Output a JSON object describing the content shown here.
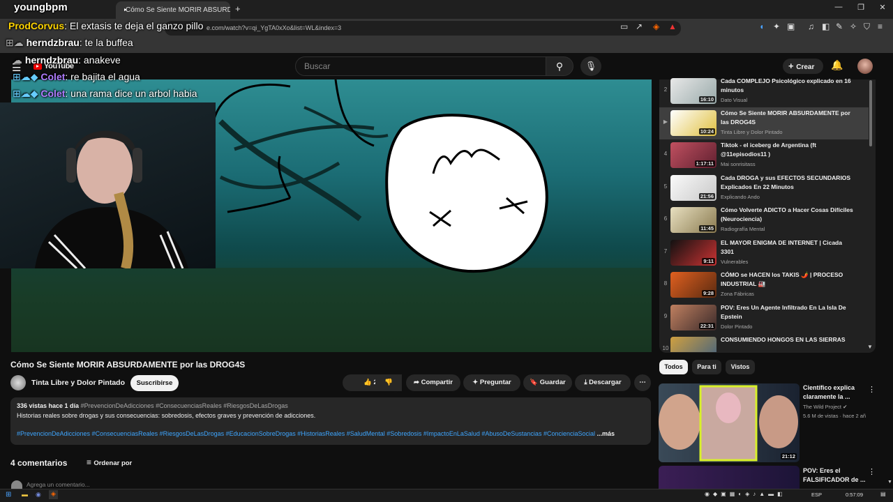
{
  "browser": {
    "active_tab_title": "Cómo Se Siente MORIR ABSURD",
    "new_tab": "+",
    "url": "e.com/watch?v=qi_YgTA0xXo&list=WL&index=3"
  },
  "youtube": {
    "logo": "YouTube",
    "search_placeholder": "Buscar",
    "create_label": "Crear"
  },
  "chat": [
    {
      "name": "youngbpm",
      "message": ""
    },
    {
      "name": "ProdCorvus",
      "message": "El extasis te deja el ganzo pillo"
    },
    {
      "name": "herndzbrau",
      "message": "te la buffea"
    },
    {
      "name": "herndzbrau",
      "message": "anakeve"
    },
    {
      "name": "Colet",
      "message": "re bajita el agua"
    },
    {
      "name": "Colet",
      "message": "una rama dice un arbol habia"
    }
  ],
  "video": {
    "title": "Cómo Se Siente MORIR ABSURDAMENTE por las DROG4S",
    "channel": "Tinta Libre y Dolor Pintado",
    "subscribe": "Suscribirse",
    "likes": "25",
    "share": "Compartir",
    "ask": "Preguntar",
    "save": "Guardar",
    "download": "Descargar",
    "views_date": "336 vistas  hace 1 día",
    "desc_tags": "#PrevencionDeAdicciones #ConsecuenciasReales #RiesgosDeLasDrogas",
    "description": "Historias reales sobre drogas y sus consecuencias: sobredosis, efectos graves y prevención de adicciones.",
    "hashtags": "#PrevencionDeAdicciones #ConsecuenciasReales #RiesgosDeLasDrogas #EducacionSobreDrogas #HistoriasReales #SaludMental #Sobredosis #ImpactoEnLaSalud #AbusoDeSustancias #ConcienciaSocial",
    "more": "...más",
    "comments_count": "4 comentarios",
    "sort_by": "Ordenar por",
    "add_comment": "Agrega un comentario..."
  },
  "playlist": [
    {
      "num": "2",
      "title": "Cada COMPLEJO Psicológico explicado en 16 minutos",
      "channel": "Dato Visual",
      "duration": "16:10"
    },
    {
      "num": "▶",
      "title": "Cómo Se Siente MORIR ABSURDAMENTE por las DROG4S",
      "channel": "Tinta Libre y Dolor Pintado",
      "duration": "10:24"
    },
    {
      "num": "4",
      "title": "Tiktok - el iceberg de Argentina (ft @11episodios11 )",
      "channel": "Mai sonrisitass",
      "duration": "1:17:11"
    },
    {
      "num": "5",
      "title": "Cada DROGA y sus EFECTOS SECUNDARIOS Explicados En 22 Minutos",
      "channel": "Explicando Ando",
      "duration": "21:56"
    },
    {
      "num": "6",
      "title": "Cómo Volverte ADICTO a Hacer Cosas Difíciles (Neurociencia)",
      "channel": "Radiografía Mental",
      "duration": "11:45"
    },
    {
      "num": "7",
      "title": "EL MAYOR ENIGMA DE INTERNET | Cicada 3301",
      "channel": "Vulnerables",
      "duration": "9:11"
    },
    {
      "num": "8",
      "title": "CÓMO se HACEN los TAKIS 🌶️ | PROCESO INDUSTRIAL 🏭",
      "channel": "Zona Fábricas",
      "duration": "9:28"
    },
    {
      "num": "9",
      "title": "POV: Eres Un Agente Infiltrado En La Isla De Epstein",
      "channel": "Dolor Pintado",
      "duration": "22:31"
    },
    {
      "num": "10",
      "title": "CONSUMIENDO HONGOS EN LAS SIERRAS",
      "channel": "",
      "duration": ""
    }
  ],
  "chips": [
    "Todos",
    "Para ti",
    "Vistos"
  ],
  "recommended": [
    {
      "title": "Científico explica claramente la ...",
      "channel": "The Wild Project",
      "meta": "5.6 M de vistas · hace 2 añ",
      "duration": "21:12"
    },
    {
      "title": "POV: Eres el FALSIFICADOR de ...",
      "channel": "",
      "meta": "",
      "duration": ""
    }
  ],
  "taskbar": {
    "lang": "ESP",
    "clock": "0:57:09"
  },
  "colors": {
    "accent_red": "#ff0000",
    "link_blue": "#3ea6ff",
    "chat_yellow": "#ffd400",
    "chat_purple": "#b07cff"
  }
}
